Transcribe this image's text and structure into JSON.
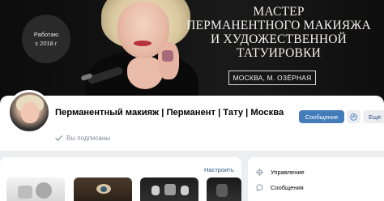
{
  "cover": {
    "badge_line1": "Работаю",
    "badge_line2": "с 2018 г",
    "title_lines": [
      "МАСТЕР",
      "ПЕРМАНЕНТНОГО МАКИЯЖА",
      "И ХУДОЖЕСТВЕННОЙ",
      "ТАТУИРОВКИ"
    ],
    "location": "МОСКВА, М. ОЗЁРНАЯ"
  },
  "profile": {
    "title": "Перманентный макияж | Перманент | Тату | Москва",
    "subscribed_label": "Вы подписаны"
  },
  "actions": {
    "message_label": "Сообщение",
    "more_label": "Ещё"
  },
  "products": {
    "configure_label": "Настроить"
  },
  "menu": {
    "items": [
      {
        "label": "Управление",
        "icon": "gear-icon"
      },
      {
        "label": "Сообщения",
        "icon": "message-icon"
      }
    ]
  },
  "colors": {
    "accent": "#447bba",
    "link": "#2a5885",
    "background": "#edeef0"
  }
}
